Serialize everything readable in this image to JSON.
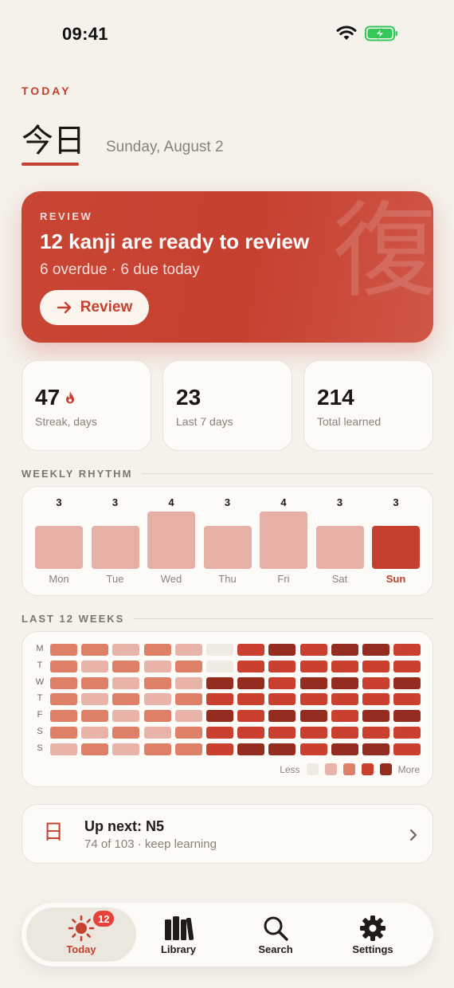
{
  "status_bar": {
    "time": "09:41"
  },
  "header": {
    "eyebrow": "TODAY",
    "title": "今日",
    "date": "Sunday, August 2"
  },
  "review": {
    "eyebrow": "REVIEW",
    "title": "12 kanji are ready to review",
    "subtitle": "6 overdue · 6 due today",
    "button_label": "Review",
    "watermark": "復"
  },
  "stats": [
    {
      "value": "47",
      "label": "Streak, days",
      "icon": "flame-icon"
    },
    {
      "value": "23",
      "label": "Last 7 days"
    },
    {
      "value": "214",
      "label": "Total learned"
    }
  ],
  "weekly_rhythm": {
    "label": "WEEKLY RHYTHM",
    "days": [
      {
        "day": "Mon",
        "count": 3
      },
      {
        "day": "Tue",
        "count": 3
      },
      {
        "day": "Wed",
        "count": 4
      },
      {
        "day": "Thu",
        "count": 3
      },
      {
        "day": "Fri",
        "count": 4
      },
      {
        "day": "Sat",
        "count": 3
      },
      {
        "day": "Sun",
        "count": 3,
        "active": true
      }
    ]
  },
  "heatmap": {
    "label": "LAST 12 WEEKS",
    "row_labels": [
      "M",
      "T",
      "W",
      "T",
      "F",
      "S",
      "S"
    ],
    "levels": [
      [
        3,
        3,
        2,
        3,
        2,
        1,
        4,
        5,
        4,
        5,
        5,
        4
      ],
      [
        3,
        2,
        3,
        2,
        3,
        1,
        4,
        4,
        4,
        4,
        4,
        4
      ],
      [
        3,
        3,
        2,
        3,
        2,
        5,
        5,
        4,
        5,
        5,
        4,
        5
      ],
      [
        3,
        2,
        3,
        2,
        3,
        4,
        4,
        4,
        4,
        4,
        4,
        4
      ],
      [
        3,
        3,
        2,
        3,
        2,
        5,
        4,
        5,
        5,
        4,
        5,
        5
      ],
      [
        3,
        2,
        3,
        2,
        3,
        4,
        4,
        4,
        4,
        4,
        4,
        4
      ],
      [
        2,
        3,
        2,
        3,
        3,
        4,
        5,
        5,
        4,
        5,
        5,
        4
      ]
    ],
    "level_colors": [
      "#efebe3",
      "#efebe3",
      "#e8b3a9",
      "#de8068",
      "#c9402f",
      "#942c20"
    ],
    "legend_less": "Less",
    "legend_more": "More",
    "legend_colors": [
      "#efebe3",
      "#e8b3a9",
      "#de8068",
      "#c9402f",
      "#942c20"
    ]
  },
  "up_next": {
    "kanji": "日",
    "title": "Up next: N5",
    "subtitle": "74 of 103 · keep learning"
  },
  "tabs": [
    {
      "label": "Today",
      "icon": "sun-icon",
      "active": true,
      "badge": "12"
    },
    {
      "label": "Library",
      "icon": "books-icon"
    },
    {
      "label": "Search",
      "icon": "search-icon"
    },
    {
      "label": "Settings",
      "icon": "gear-icon"
    }
  ],
  "colors": {
    "accent": "#c5402f",
    "background": "#f5f2ec",
    "card": "#fdfbf7"
  }
}
